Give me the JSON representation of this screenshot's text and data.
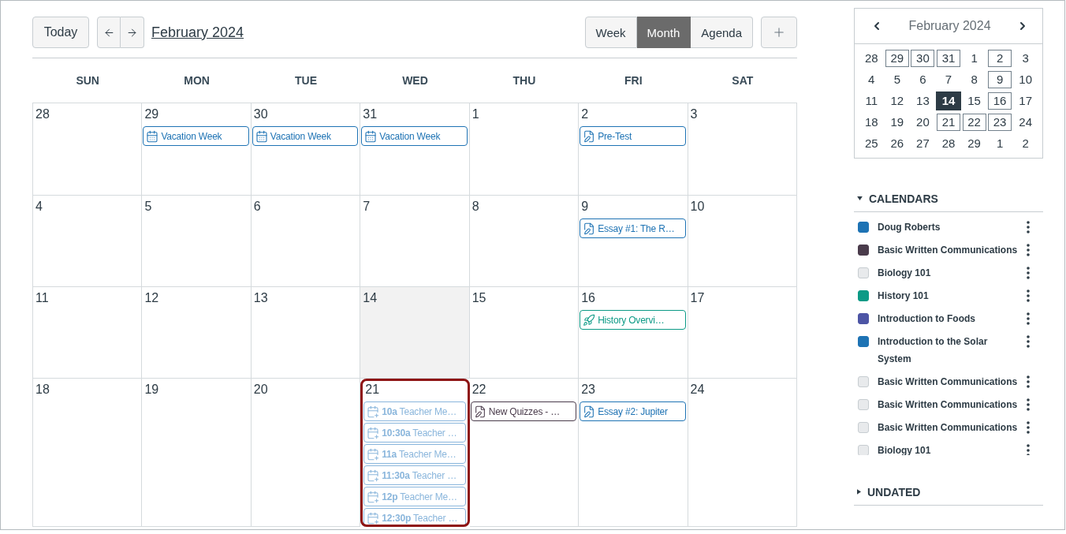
{
  "toolbar": {
    "today_button": "Today",
    "title": "February 2024",
    "views": [
      {
        "label": "Week",
        "selected": false
      },
      {
        "label": "Month",
        "selected": true
      },
      {
        "label": "Agenda",
        "selected": false
      }
    ]
  },
  "weekdays": [
    "SUN",
    "MON",
    "TUE",
    "WED",
    "THU",
    "FRI",
    "SAT"
  ],
  "weeks": [
    {
      "days": [
        {
          "day": "28",
          "today": false,
          "highlighted": false
        },
        {
          "day": "29",
          "today": false,
          "highlighted": false,
          "events": [
            {
              "kind": "event",
              "title": "Vacation Week",
              "color": "#1e73b4"
            }
          ]
        },
        {
          "day": "30",
          "today": false,
          "highlighted": false,
          "events": [
            {
              "kind": "event",
              "title": "Vacation Week",
              "color": "#1e73b4"
            }
          ]
        },
        {
          "day": "31",
          "today": false,
          "highlighted": false,
          "events": [
            {
              "kind": "event",
              "title": "Vacation Week",
              "color": "#1e73b4"
            }
          ]
        },
        {
          "day": "1",
          "today": false,
          "highlighted": false
        },
        {
          "day": "2",
          "today": false,
          "highlighted": false,
          "events": [
            {
              "kind": "assignment",
              "title": "Pre-Test",
              "color": "#1e73b4"
            }
          ]
        },
        {
          "day": "3",
          "today": false,
          "highlighted": false
        }
      ]
    },
    {
      "days": [
        {
          "day": "4",
          "today": false,
          "highlighted": false
        },
        {
          "day": "5",
          "today": false,
          "highlighted": false
        },
        {
          "day": "6",
          "today": false,
          "highlighted": false
        },
        {
          "day": "7",
          "today": false,
          "highlighted": false
        },
        {
          "day": "8",
          "today": false,
          "highlighted": false
        },
        {
          "day": "9",
          "today": false,
          "highlighted": false,
          "events": [
            {
              "kind": "assignment",
              "title": "Essay #1: The R…",
              "color": "#1e73b4"
            }
          ]
        },
        {
          "day": "10",
          "today": false,
          "highlighted": false
        }
      ]
    },
    {
      "days": [
        {
          "day": "11",
          "today": false,
          "highlighted": false
        },
        {
          "day": "12",
          "today": false,
          "highlighted": false
        },
        {
          "day": "13",
          "today": false,
          "highlighted": false
        },
        {
          "day": "14",
          "today": true,
          "highlighted": false
        },
        {
          "day": "15",
          "today": false,
          "highlighted": false
        },
        {
          "day": "16",
          "today": false,
          "highlighted": false,
          "events": [
            {
              "kind": "quiz",
              "title": "History Overvi…",
              "color": "#0c9a86"
            }
          ]
        },
        {
          "day": "17",
          "today": false,
          "highlighted": false
        }
      ]
    },
    {
      "days": [
        {
          "day": "18",
          "today": false,
          "highlighted": false
        },
        {
          "day": "19",
          "today": false,
          "highlighted": false
        },
        {
          "day": "20",
          "today": false,
          "highlighted": false
        },
        {
          "day": "21",
          "today": false,
          "highlighted": true,
          "events": [
            {
              "kind": "appointment",
              "title": "**10a** Teacher Me…",
              "color": "#8ab6dc"
            },
            {
              "kind": "appointment",
              "title": "**10:30a** Teacher …",
              "color": "#8ab6dc"
            },
            {
              "kind": "appointment",
              "title": "**11a** Teacher Me…",
              "color": "#8ab6dc"
            },
            {
              "kind": "appointment",
              "title": "**11:30a** Teacher …",
              "color": "#8ab6dc"
            },
            {
              "kind": "appointment",
              "title": "**12p** Teacher Me…",
              "color": "#8ab6dc"
            },
            {
              "kind": "appointment",
              "title": "**12:30p** Teacher …",
              "color": "#8ab6dc"
            }
          ]
        },
        {
          "day": "22",
          "today": false,
          "highlighted": false,
          "events": [
            {
              "kind": "assignment",
              "title": "New Quizzes - …",
              "color": "#4a3b4b"
            }
          ]
        },
        {
          "day": "23",
          "today": false,
          "highlighted": false,
          "events": [
            {
              "kind": "assignment",
              "title": "Essay #2: Jupiter",
              "color": "#1e73b4"
            }
          ]
        },
        {
          "day": "24",
          "today": false,
          "highlighted": false
        }
      ]
    }
  ],
  "mini_calendar": {
    "title": "February 2024",
    "weeks": [
      {
        "days": [
          {
            "day": "28",
            "has_events": false,
            "selected": false
          },
          {
            "day": "29",
            "has_events": true,
            "selected": false
          },
          {
            "day": "30",
            "has_events": true,
            "selected": false
          },
          {
            "day": "31",
            "has_events": true,
            "selected": false
          },
          {
            "day": "1",
            "has_events": false,
            "selected": false
          },
          {
            "day": "2",
            "has_events": true,
            "selected": false
          },
          {
            "day": "3",
            "has_events": false,
            "selected": false
          }
        ]
      },
      {
        "days": [
          {
            "day": "4",
            "has_events": false,
            "selected": false
          },
          {
            "day": "5",
            "has_events": false,
            "selected": false
          },
          {
            "day": "6",
            "has_events": false,
            "selected": false
          },
          {
            "day": "7",
            "has_events": false,
            "selected": false
          },
          {
            "day": "8",
            "has_events": false,
            "selected": false
          },
          {
            "day": "9",
            "has_events": true,
            "selected": false
          },
          {
            "day": "10",
            "has_events": false,
            "selected": false
          }
        ]
      },
      {
        "days": [
          {
            "day": "11",
            "has_events": false,
            "selected": false
          },
          {
            "day": "12",
            "has_events": false,
            "selected": false
          },
          {
            "day": "13",
            "has_events": false,
            "selected": false
          },
          {
            "day": "14",
            "has_events": false,
            "selected": true
          },
          {
            "day": "15",
            "has_events": false,
            "selected": false
          },
          {
            "day": "16",
            "has_events": true,
            "selected": false
          },
          {
            "day": "17",
            "has_events": false,
            "selected": false
          }
        ]
      },
      {
        "days": [
          {
            "day": "18",
            "has_events": false,
            "selected": false
          },
          {
            "day": "19",
            "has_events": false,
            "selected": false
          },
          {
            "day": "20",
            "has_events": false,
            "selected": false
          },
          {
            "day": "21",
            "has_events": true,
            "selected": false
          },
          {
            "day": "22",
            "has_events": true,
            "selected": false
          },
          {
            "day": "23",
            "has_events": true,
            "selected": false
          },
          {
            "day": "24",
            "has_events": false,
            "selected": false
          }
        ]
      },
      {
        "days": [
          {
            "day": "25",
            "has_events": false,
            "selected": false
          },
          {
            "day": "26",
            "has_events": false,
            "selected": false
          },
          {
            "day": "27",
            "has_events": false,
            "selected": false
          },
          {
            "day": "28",
            "has_events": false,
            "selected": false
          },
          {
            "day": "29",
            "has_events": false,
            "selected": false
          },
          {
            "day": "1",
            "has_events": false,
            "selected": false
          },
          {
            "day": "2",
            "has_events": false,
            "selected": false
          }
        ]
      }
    ]
  },
  "calendars": {
    "title": "CALENDARS",
    "expanded": true,
    "items": [
      {
        "name": "Doug Roberts",
        "checked": true,
        "color": "#1e73b4"
      },
      {
        "name": "Basic Written Communications",
        "checked": true,
        "color": "#4a3b4b"
      },
      {
        "name": "Biology 101",
        "checked": false
      },
      {
        "name": "History 101",
        "checked": true,
        "color": "#0c9a86"
      },
      {
        "name": "Introduction to Foods",
        "checked": true,
        "color": "#4d55a5"
      },
      {
        "name": "Introduction to the Solar System",
        "checked": true,
        "color": "#1e73b4"
      },
      {
        "name": "Basic Written Communications",
        "checked": false
      },
      {
        "name": "Basic Written Communications",
        "checked": false
      },
      {
        "name": "Basic Written Communications",
        "checked": false
      },
      {
        "name": "Biology 101",
        "checked": false
      }
    ]
  },
  "undated": {
    "title": "UNDATED",
    "expanded": false
  }
}
